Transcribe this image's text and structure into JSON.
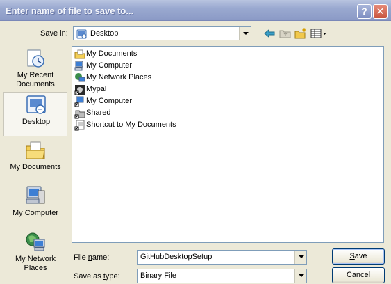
{
  "window": {
    "title": "Enter name of file to save to...",
    "help_symbol": "?",
    "close_symbol": "✕"
  },
  "save_in": {
    "label": "Save in:",
    "value": "Desktop",
    "icons": [
      "desktop-icon",
      "back-arrow-icon",
      "up-folder-icon",
      "new-folder-icon",
      "views-menu-icon"
    ]
  },
  "places": [
    {
      "label_line1": "My Recent",
      "label_line2": "Documents",
      "icon": "recent-documents-icon"
    },
    {
      "label_line1": "Desktop",
      "label_line2": "",
      "icon": "desktop-icon"
    },
    {
      "label_line1": "My Documents",
      "label_line2": "",
      "icon": "my-documents-icon"
    },
    {
      "label_line1": "My Computer",
      "label_line2": "",
      "icon": "my-computer-icon"
    },
    {
      "label_line1": "My Network",
      "label_line2": "Places",
      "icon": "network-places-icon"
    }
  ],
  "files": [
    {
      "name": "My Documents",
      "icon": "my-documents-icon"
    },
    {
      "name": "My Computer",
      "icon": "my-computer-icon"
    },
    {
      "name": "My Network Places",
      "icon": "network-places-icon"
    },
    {
      "name": "Mypal",
      "icon": "mypal-shortcut-icon"
    },
    {
      "name": "My Computer",
      "icon": "computer-shortcut-icon"
    },
    {
      "name": "Shared",
      "icon": "shared-shortcut-icon"
    },
    {
      "name": "Shortcut to My Documents",
      "icon": "documents-shortcut-icon"
    }
  ],
  "file_name": {
    "label_pre": "File ",
    "label_ul": "n",
    "label_post": "ame:",
    "value": "GitHubDesktopSetup"
  },
  "save_as_type": {
    "label_pre": "Save as ",
    "label_ul": "t",
    "label_post": "ype:",
    "value": "Binary File"
  },
  "buttons": {
    "save_ul": "S",
    "save_post": "ave",
    "cancel": "Cancel"
  },
  "colors": {
    "title_bar": "#9aa9d0",
    "close_button": "#c8553e",
    "field_border": "#7f9db9"
  }
}
